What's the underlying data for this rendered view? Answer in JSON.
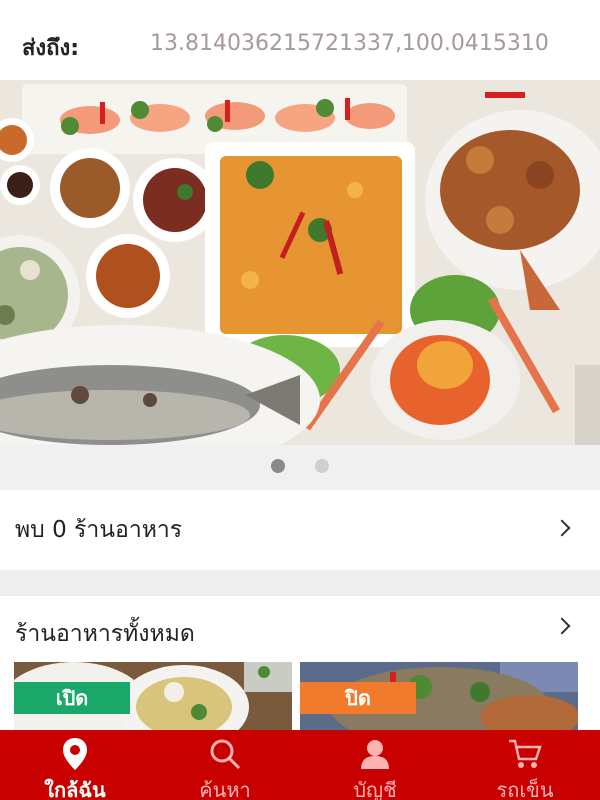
{
  "header": {
    "deliver_to_label": "ส่งถึง:",
    "coordinates": "13.814036215721337,100.0415310"
  },
  "banner": {
    "image": "thai-seafood-feast-banner",
    "dots_total": 2,
    "active_dot": 1
  },
  "found_row": {
    "label": "พบ 0 ร้านอาหาร"
  },
  "all_row": {
    "label": "ร้านอาหารทั้งหมด"
  },
  "restaurants": [
    {
      "status": "เปิด",
      "status_color": "#1aa86a"
    },
    {
      "status": "ปิด",
      "status_color": "#f07b2c"
    }
  ],
  "tabbar": {
    "color": "#c80000",
    "tabs": [
      {
        "label": "ใกล้ฉัน",
        "icon": "map-pin-icon",
        "active": true
      },
      {
        "label": "ค้นหา",
        "icon": "search-icon",
        "active": false
      },
      {
        "label": "บัญชี",
        "icon": "user-icon",
        "active": false
      },
      {
        "label": "รถเข็น",
        "icon": "cart-icon",
        "active": false
      }
    ]
  }
}
